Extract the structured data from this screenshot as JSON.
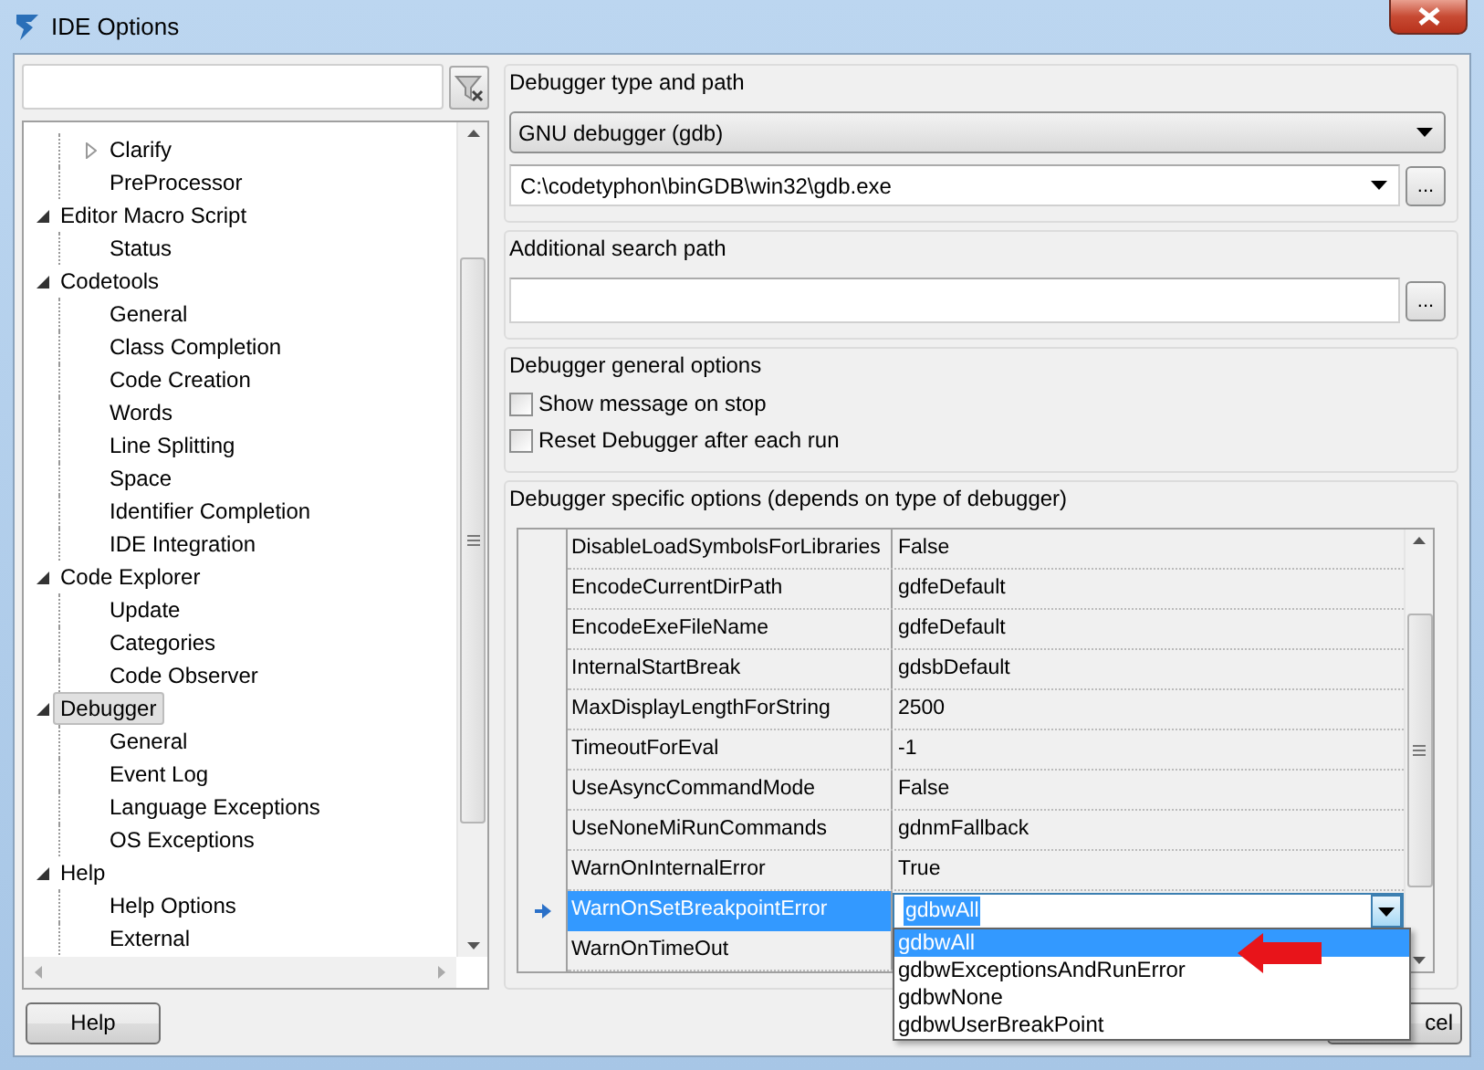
{
  "window": {
    "title": "IDE Options"
  },
  "tree": [
    {
      "children": [
        {
          "label": "Clarify",
          "expanded": false,
          "selected": false
        },
        {
          "label": "PreProcessor",
          "selected": false
        }
      ]
    },
    {
      "label": "Editor Macro Script",
      "expanded": true,
      "selected": false,
      "children": [
        {
          "label": "Status",
          "selected": false
        }
      ]
    },
    {
      "label": "Codetools",
      "expanded": true,
      "selected": false,
      "children": [
        {
          "label": "General",
          "selected": false
        },
        {
          "label": "Class Completion",
          "selected": false
        },
        {
          "label": "Code Creation",
          "selected": false
        },
        {
          "label": "Words",
          "selected": false
        },
        {
          "label": "Line Splitting",
          "selected": false
        },
        {
          "label": "Space",
          "selected": false
        },
        {
          "label": "Identifier Completion",
          "selected": false
        },
        {
          "label": "IDE Integration",
          "selected": false
        }
      ]
    },
    {
      "label": "Code Explorer",
      "expanded": true,
      "selected": false,
      "children": [
        {
          "label": "Update",
          "selected": false
        },
        {
          "label": "Categories",
          "selected": false
        },
        {
          "label": "Code Observer",
          "selected": false
        }
      ]
    },
    {
      "label": "Debugger",
      "expanded": true,
      "selected": true,
      "children": [
        {
          "label": "General",
          "selected": false
        },
        {
          "label": "Event Log",
          "selected": false
        },
        {
          "label": "Language Exceptions",
          "selected": false
        },
        {
          "label": "OS Exceptions",
          "selected": false
        }
      ]
    },
    {
      "label": "Help",
      "expanded": true,
      "selected": false,
      "children": [
        {
          "label": "Help Options",
          "selected": false
        },
        {
          "label": "External",
          "selected": false
        }
      ]
    }
  ],
  "type_group": {
    "title": "Debugger type and path",
    "debugger": "GNU debugger (gdb)",
    "path": "C:\\codetyphon\\binGDB\\win32\\gdb.exe",
    "browse": "..."
  },
  "search_group": {
    "title": "Additional search path",
    "value_browse": "..."
  },
  "general_group": {
    "title": "Debugger general options",
    "options": [
      {
        "label": "Show message on stop",
        "checked": false
      },
      {
        "label": "Reset Debugger after each run",
        "checked": false
      }
    ]
  },
  "specific_group": {
    "title": "Debugger specific options (depends on type of debugger)",
    "rows": [
      {
        "name": "DisableLoadSymbolsForLibraries",
        "value": "False",
        "selected": false
      },
      {
        "name": "EncodeCurrentDirPath",
        "value": "gdfeDefault",
        "selected": false
      },
      {
        "name": "EncodeExeFileName",
        "value": "gdfeDefault",
        "selected": false
      },
      {
        "name": "InternalStartBreak",
        "value": "gdsbDefault",
        "selected": false
      },
      {
        "name": "MaxDisplayLengthForString",
        "value": "2500",
        "selected": false
      },
      {
        "name": "TimeoutForEval",
        "value": "-1",
        "selected": false
      },
      {
        "name": "UseAsyncCommandMode",
        "value": "False",
        "selected": false
      },
      {
        "name": "UseNoneMiRunCommands",
        "value": "gdnmFallback",
        "selected": false
      },
      {
        "name": "WarnOnInternalError",
        "value": "True",
        "selected": false
      },
      {
        "name": "WarnOnSetBreakpointError",
        "value": "gdbwAll",
        "selected": true
      },
      {
        "name": "WarnOnTimeOut",
        "value": "",
        "selected": false
      }
    ],
    "dropdown": [
      {
        "label": "gdbwAll",
        "selected": true
      },
      {
        "label": "gdbwExceptionsAndRunError",
        "selected": false
      },
      {
        "label": "gdbwNone",
        "selected": false
      },
      {
        "label": "gdbwUserBreakPoint",
        "selected": false
      }
    ]
  },
  "buttons": {
    "help": "Help",
    "cancel": "cel"
  }
}
